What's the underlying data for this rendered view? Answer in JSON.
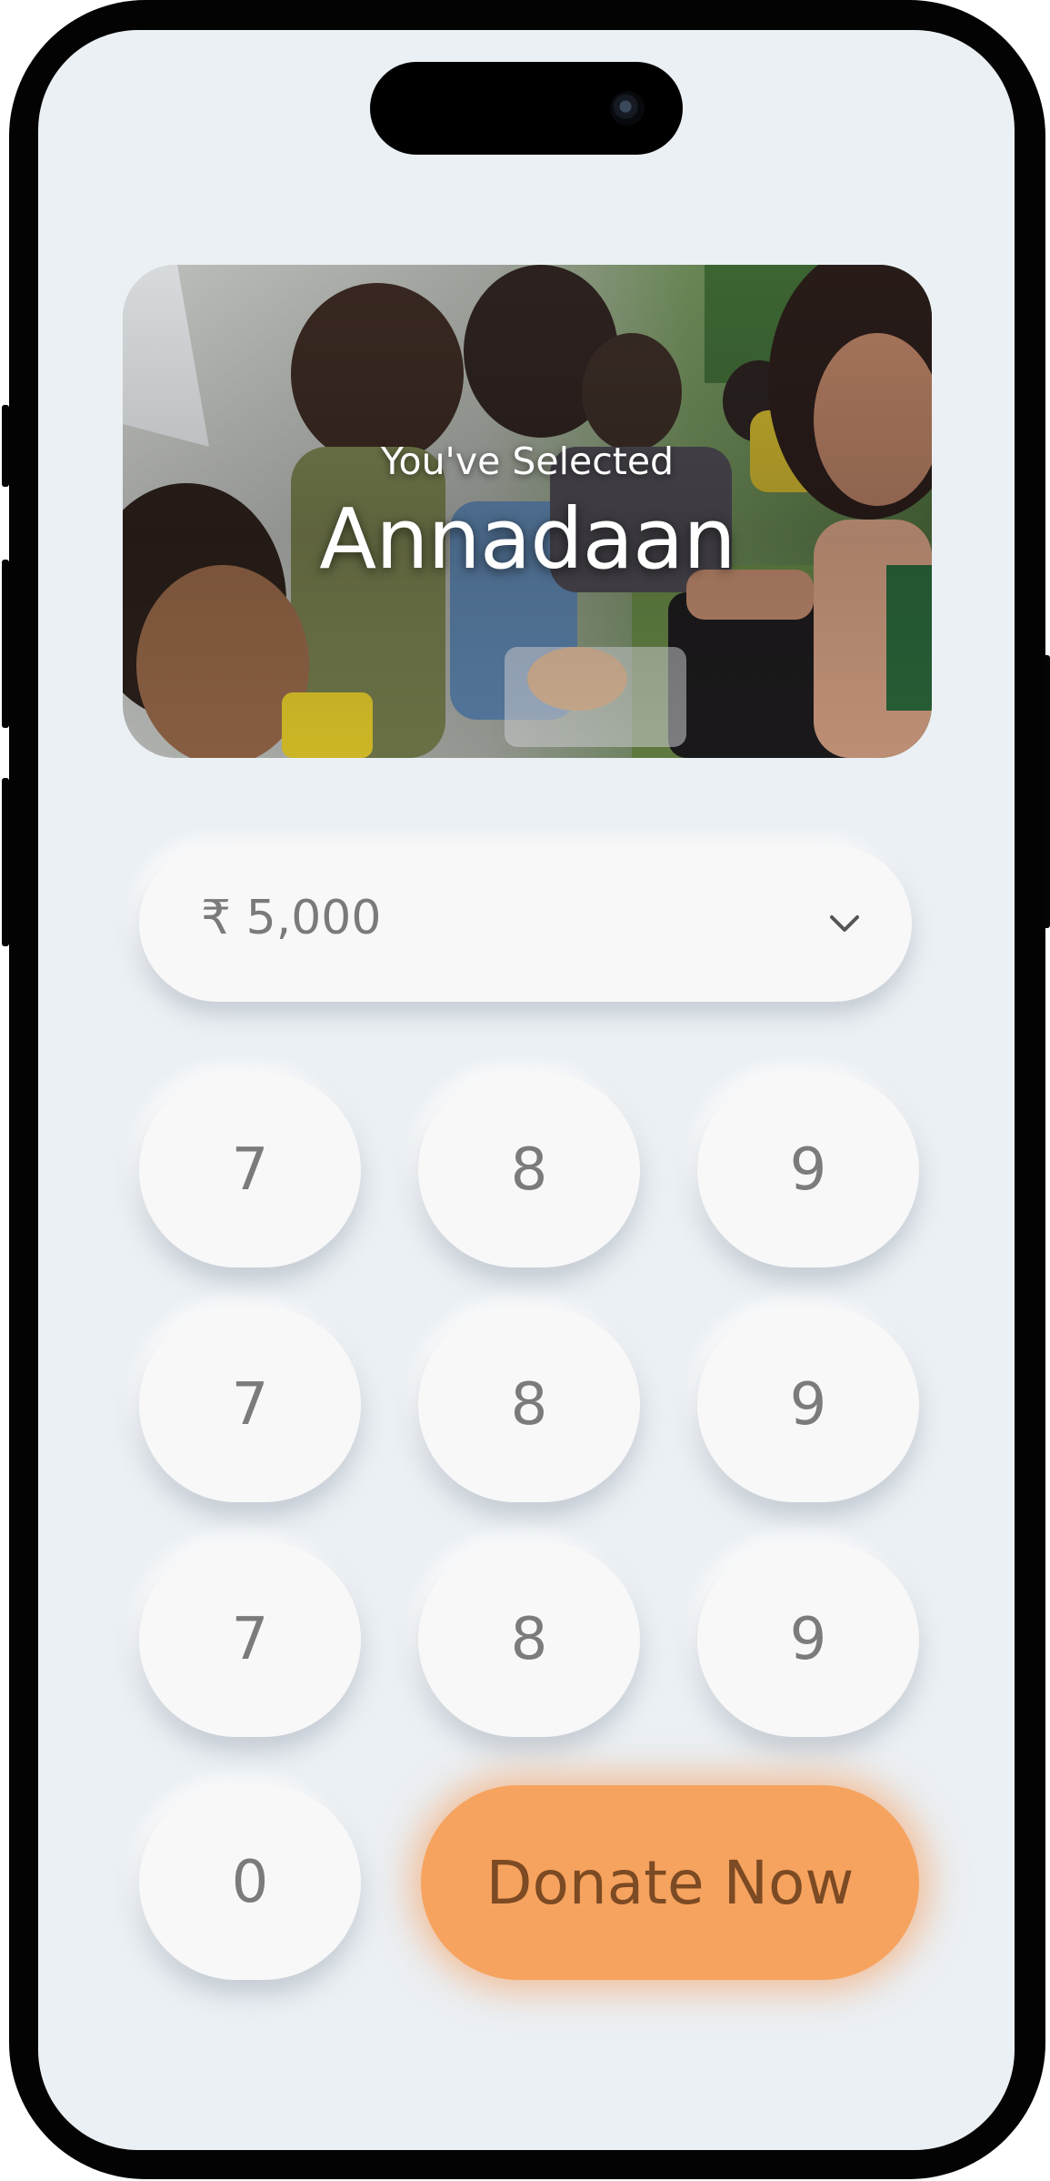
{
  "hero": {
    "subtitle": "You've Selected",
    "title": "Annadaan"
  },
  "amount": {
    "value": "₹ 5,000",
    "dropdown_icon": "chevron-down-icon"
  },
  "keypad": {
    "rows": [
      [
        "7",
        "8",
        "9"
      ],
      [
        "7",
        "8",
        "9"
      ],
      [
        "7",
        "8",
        "9"
      ]
    ],
    "zero": "0"
  },
  "donate_label": "Donate Now",
  "colors": {
    "screen_bg": "#ebf0f4",
    "key_bg": "#f8f8f8",
    "key_text": "#7b7b7b",
    "accent": "#f6a35f",
    "accent_text": "#7c4a23"
  }
}
